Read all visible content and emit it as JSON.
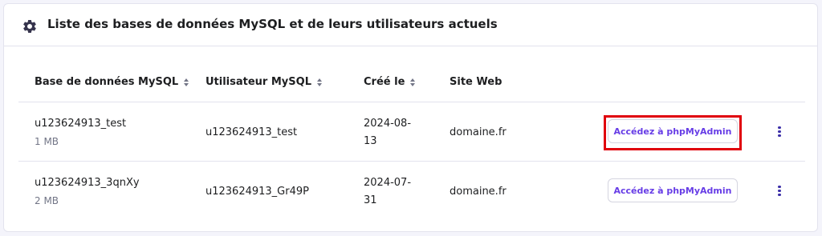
{
  "card": {
    "title": "Liste des bases de données MySQL et de leurs utilisateurs actuels",
    "icon": "gear-icon"
  },
  "table": {
    "columns": [
      {
        "label": "Base de données MySQL",
        "sortable": true
      },
      {
        "label": "Utilisateur MySQL",
        "sortable": true
      },
      {
        "label": "Créé le",
        "sortable": true
      },
      {
        "label": "Site Web",
        "sortable": false
      }
    ],
    "rows": [
      {
        "database": "u123624913_test",
        "size": "1 MB",
        "user": "u123624913_test",
        "created_line1": "2024-08-",
        "created_line2": "13",
        "website": "domaine.fr",
        "action_label": "Accédez à phpMyAdmin",
        "highlighted": true
      },
      {
        "database": "u123624913_3qnXy",
        "size": "2 MB",
        "user": "u123624913_Gr49P",
        "created_line1": "2024-07-",
        "created_line2": "31",
        "website": "domaine.fr",
        "action_label": "Accédez à phpMyAdmin",
        "highlighted": false
      }
    ]
  },
  "colors": {
    "accent": "#673de6",
    "highlight": "#e0000b",
    "kebab": "#3b2ea8"
  }
}
